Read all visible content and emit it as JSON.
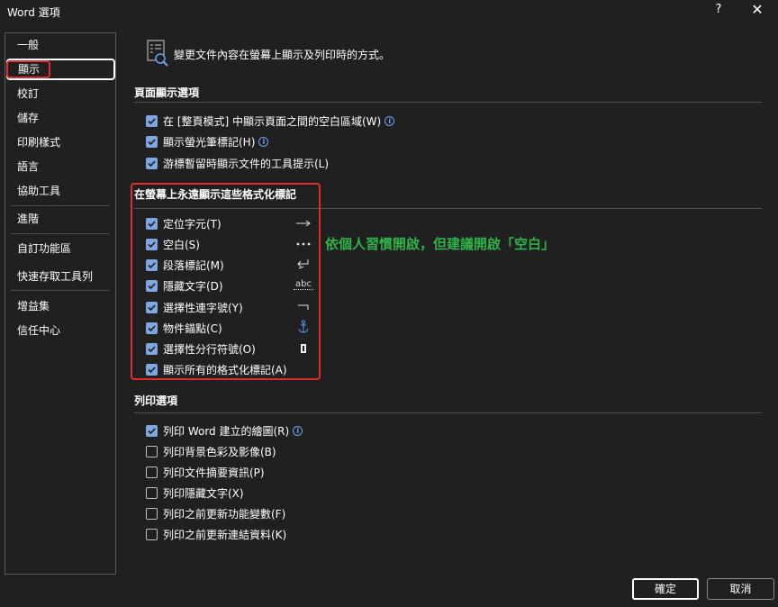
{
  "window": {
    "title": "Word 選項",
    "help_label": "?",
    "close_label": "✕"
  },
  "sidebar": {
    "items": [
      {
        "label": "一般"
      },
      {
        "label": "顯示"
      },
      {
        "label": "校訂"
      },
      {
        "label": "儲存"
      },
      {
        "label": "印刷樣式"
      },
      {
        "label": "語言"
      },
      {
        "label": "協助工具"
      },
      {
        "label": "進階"
      },
      {
        "label": "自訂功能區"
      },
      {
        "label": "快速存取工具列"
      },
      {
        "label": "增益集"
      },
      {
        "label": "信任中心"
      }
    ],
    "selected": "顯示"
  },
  "header": {
    "icon": "display-options-icon",
    "text": "變更文件內容在螢幕上顯示及列印時的方式。"
  },
  "page_display": {
    "title": "頁面顯示選項",
    "options": [
      {
        "label": "在 [整頁模式] 中顯示頁面之間的空白區域(W)",
        "checked": true,
        "info": true
      },
      {
        "label": "顯示螢光筆標記(H)",
        "checked": true,
        "info": true
      },
      {
        "label": "游標暫留時顯示文件的工具提示(L)",
        "checked": true,
        "info": false
      }
    ]
  },
  "formatting_marks": {
    "title": "在螢幕上永遠顯示這些格式化標記",
    "options": [
      {
        "label": "定位字元(T)",
        "checked": true,
        "mark": "tab-arrow-icon"
      },
      {
        "label": "空白(S)",
        "checked": true,
        "mark": "space-dots-icon"
      },
      {
        "label": "段落標記(M)",
        "checked": true,
        "mark": "paragraph-mark-icon"
      },
      {
        "label": "隱藏文字(D)",
        "checked": true,
        "mark": "hidden-text-icon",
        "mark_text": "abc"
      },
      {
        "label": "選擇性連字號(Y)",
        "checked": true,
        "mark": "optional-hyphen-icon"
      },
      {
        "label": "物件錨點(C)",
        "checked": true,
        "mark": "anchor-icon"
      },
      {
        "label": "選擇性分行符號(O)",
        "checked": true,
        "mark": "optional-break-icon"
      },
      {
        "label": "顯示所有的格式化標記(A)",
        "checked": true
      }
    ]
  },
  "annotation": "依個人習慣開啟，但建議開啟「空白」",
  "print": {
    "title": "列印選項",
    "options": [
      {
        "label": "列印 Word 建立的繪圖(R)",
        "checked": true,
        "info": true
      },
      {
        "label": "列印背景色彩及影像(B)",
        "checked": false
      },
      {
        "label": "列印文件摘要資訊(P)",
        "checked": false
      },
      {
        "label": "列印隱藏文字(X)",
        "checked": false
      },
      {
        "label": "列印之前更新功能變數(F)",
        "checked": false
      },
      {
        "label": "列印之前更新連結資料(K)",
        "checked": false
      }
    ]
  },
  "footer": {
    "ok_label": "確定",
    "cancel_label": "取消"
  },
  "colors": {
    "background": "#202020",
    "checkbox_checked": "#7fa6e0",
    "highlight_red": "#e22c2c",
    "annotation_green": "#2fb14a",
    "info_blue": "#6fa3ee"
  }
}
